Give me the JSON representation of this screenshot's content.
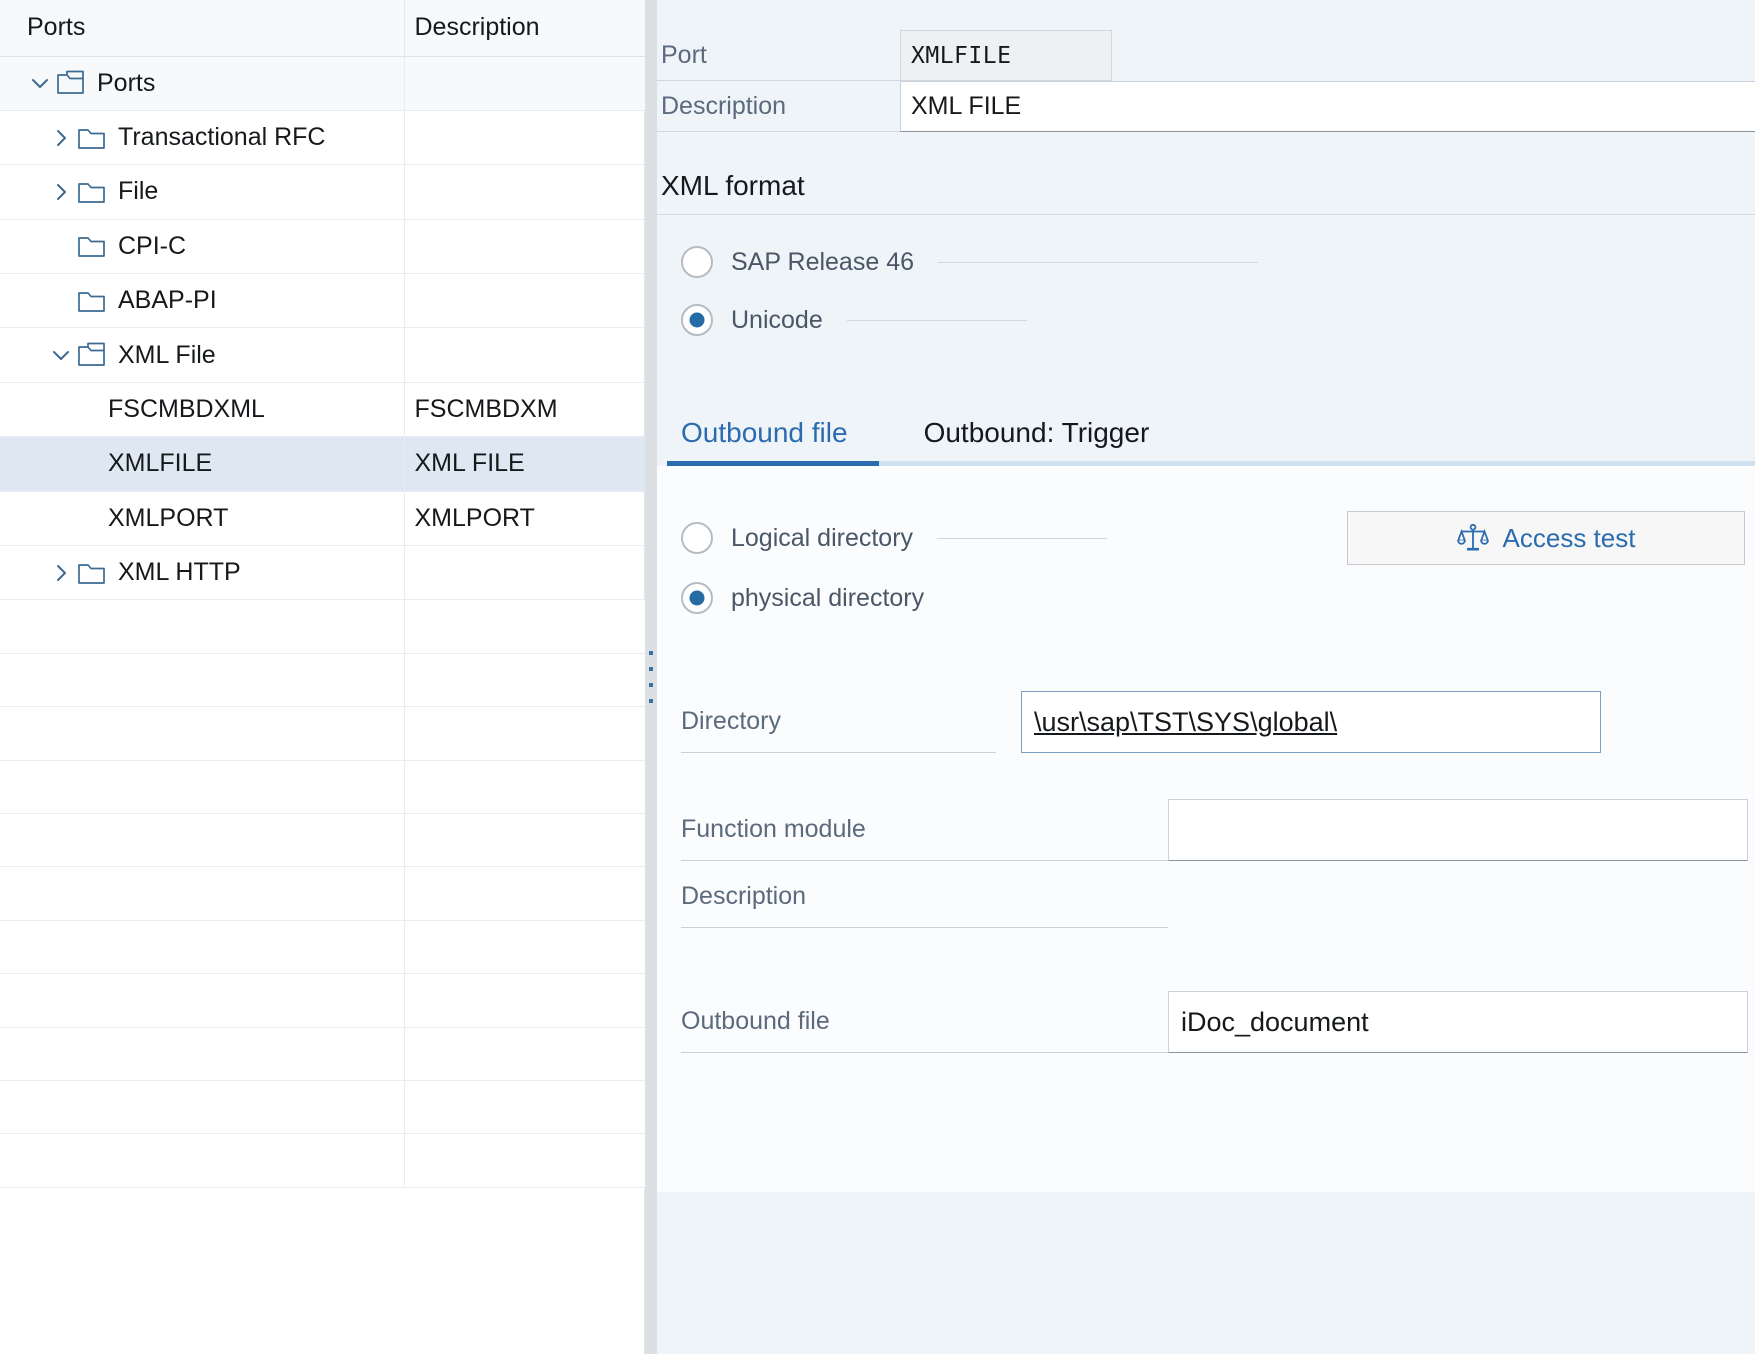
{
  "left_panel": {
    "columns": [
      "Ports",
      "Description"
    ],
    "rows": [
      {
        "label": "Ports",
        "description": "",
        "level": 0,
        "icon": "folder-open-icon",
        "twisty": "chevron-down",
        "state": "root"
      },
      {
        "label": "Transactional RFC",
        "description": "",
        "level": 1,
        "icon": "folder-closed-icon",
        "twisty": "chevron-right",
        "state": "normal"
      },
      {
        "label": "File",
        "description": "",
        "level": 1,
        "icon": "folder-closed-icon",
        "twisty": "chevron-right",
        "state": "normal"
      },
      {
        "label": "CPI-C",
        "description": "",
        "level": 1,
        "icon": "folder-closed-icon",
        "twisty": "none",
        "state": "normal"
      },
      {
        "label": "ABAP-PI",
        "description": "",
        "level": 1,
        "icon": "folder-closed-icon",
        "twisty": "none",
        "state": "normal"
      },
      {
        "label": "XML File",
        "description": "",
        "level": 1,
        "icon": "folder-open-icon",
        "twisty": "chevron-down",
        "state": "normal"
      },
      {
        "label": "FSCMBDXML",
        "description": "FSCMBDXM",
        "level": 2,
        "icon": "none",
        "twisty": "none",
        "state": "normal"
      },
      {
        "label": "XMLFILE",
        "description": "XML FILE",
        "level": 2,
        "icon": "none",
        "twisty": "none",
        "state": "selected"
      },
      {
        "label": "XMLPORT",
        "description": "XMLPORT",
        "level": 2,
        "icon": "none",
        "twisty": "none",
        "state": "normal"
      },
      {
        "label": "XML HTTP",
        "description": "",
        "level": 1,
        "icon": "folder-closed-icon",
        "twisty": "chevron-right",
        "state": "normal"
      }
    ],
    "empty_row_count": 11
  },
  "detail": {
    "port_label": "Port",
    "port_value": "XMLFILE",
    "description_label": "Description",
    "description_value": "XML FILE",
    "xml_format": {
      "title": "XML format",
      "options": [
        {
          "label": "SAP Release 46",
          "selected": false
        },
        {
          "label": "Unicode",
          "selected": true
        }
      ]
    },
    "tabs": [
      {
        "label": "Outbound file",
        "active": true
      },
      {
        "label": "Outbound: Trigger",
        "active": false
      }
    ],
    "directory_mode": [
      {
        "label": "Logical directory",
        "selected": false
      },
      {
        "label": "physical directory",
        "selected": true
      }
    ],
    "access_test_button": "Access test",
    "access_test_icon": "scales-icon",
    "fields": [
      {
        "label": "Directory",
        "value": "\\usr\\sap\\TST\\SYS\\global\\",
        "focused": true
      },
      {
        "label": "Function module",
        "value": "",
        "focused": false
      },
      {
        "label": "Description",
        "value": "",
        "focused": false
      },
      {
        "label": "Outbound file",
        "value": "iDoc_document",
        "focused": false
      }
    ]
  },
  "colors": {
    "accent": "#2b6caf",
    "selected_row": "#dee8f3",
    "panel_bg": "#eff4f9",
    "tab_content_bg": "#fbfcfd",
    "label_text": "#5b6a7d",
    "folder_outline": "#3b6a93"
  }
}
